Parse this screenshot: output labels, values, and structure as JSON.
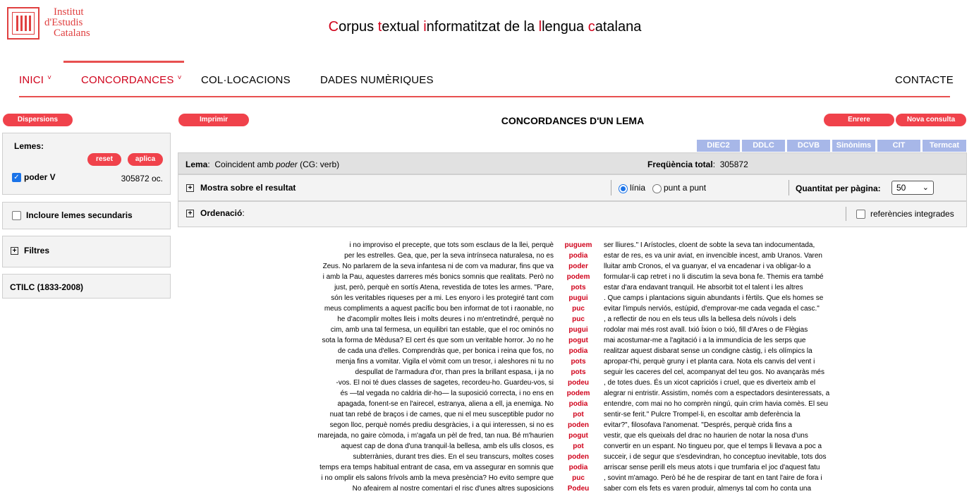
{
  "logo": {
    "line1": "Institut",
    "line2": "d'Estudis",
    "line3": "Catalans"
  },
  "site_title": {
    "parts": [
      {
        "t": "C",
        "red": true
      },
      {
        "t": "orpus ",
        "red": false
      },
      {
        "t": "t",
        "red": true
      },
      {
        "t": "extual ",
        "red": false
      },
      {
        "t": "i",
        "red": true
      },
      {
        "t": "nformatitzat de la ",
        "red": false
      },
      {
        "t": "l",
        "red": true
      },
      {
        "t": "lengua ",
        "red": false
      },
      {
        "t": "c",
        "red": true
      },
      {
        "t": "atalana",
        "red": false
      }
    ]
  },
  "nav": {
    "inici": "INICI",
    "concordances": "CONCORDANCES",
    "collocacions": "COL·LOCACIONS",
    "dades": "DADES NUMÈRIQUES",
    "contacte": "CONTACTE"
  },
  "buttons": {
    "dispersions": "Dispersions",
    "imprimir": "Imprimir",
    "enrere": "Enrere",
    "nova": "Nova consulta",
    "reset": "reset",
    "aplica": "aplica"
  },
  "page_title": "CONCORDANCES D'UN LEMA",
  "sidebar": {
    "lemes_label": "Lemes",
    "lema_item": "poder V",
    "lema_count": "305872 oc.",
    "secundaris": "Incloure lemes secundaris",
    "filtres": "Filtres",
    "ctilc": "CTILC (1833-2008)"
  },
  "dict_tabs": [
    "DIEC2",
    "DDLC",
    "DCVB",
    "Sinònims",
    "CIT",
    "Termcat"
  ],
  "lema_bar": {
    "label": "Lema",
    "desc_pre": "Coincident amb ",
    "desc_em": "poder",
    "desc_post": " (CG: verb)",
    "freq_label": "Freqüència total",
    "freq_value": "305872"
  },
  "options_bar": {
    "mostra": "Mostra sobre el resultat",
    "linia": "línia",
    "punt": "punt a punt",
    "quantitat": "Quantitat per pàgina:",
    "quantitat_value": "50"
  },
  "ordenacio_bar": {
    "label": "Ordenació",
    "referencies": "referències integrades"
  },
  "concordances": [
    {
      "l": "i no improviso el precepte, que tots som esclaus de la llei, perquè",
      "k": "puguem",
      "r": "ser lliures.\" I Arístocles, cloent de sobte la seva tan indocumentada,"
    },
    {
      "l": "per les estrelles. Gea, que, per la seva intrínseca naturalesa, no es",
      "k": "podia",
      "r": "estar de res, es va unir aviat, en invencible incest, amb Uranos. Varen"
    },
    {
      "l": "Zeus. No parlarem de la seva infantesa ni de com va madurar, fins que va",
      "k": "poder",
      "r": "lluitar amb Cronos, el va guanyar, el va encadenar i va obligar-lo a"
    },
    {
      "l": "i amb la Pau, aquestes darreres més bonics somnis que realitats. Però no",
      "k": "podem",
      "r": "formular-li cap retret i no li discutim la seva bona fe. Themis era també"
    },
    {
      "l": "just, però, perquè en sortís Atena, revestida de totes les armes. \"Pare,",
      "k": "pots",
      "r": "estar d'ara endavant tranquil. He absorbit tot el talent i les altres"
    },
    {
      "l": "són les veritables riqueses per a mi. Les enyoro i les protegiré tant com",
      "k": "pugui",
      "r": ". Que camps i plantacions siguin abundants i fèrtils. Que els homes se"
    },
    {
      "l": "meus compliments a aquest pacífic bou ben informat de tot i raonable, no",
      "k": "puc",
      "r": "evitar l'impuls nerviós, estúpid, d'emprovar-me cada vegada el casc.\""
    },
    {
      "l": "he d'acomplir moltes lleis i molts deures i no m'entretindré, perquè no",
      "k": "puc",
      "r": ", a reflectir de nou en els teus ulls la bellesa dels núvols i dels"
    },
    {
      "l": "cim, amb una tal fermesa, un equilibri tan estable, que el roc ominós no",
      "k": "pugui",
      "r": "rodolar mai més rost avall. Ixió Íxion o Ixió, fill d'Ares o de Flègias"
    },
    {
      "l": "sota la forma de Mèdusa? El cert és que som un veritable horror. Jo no he",
      "k": "pogut",
      "r": "mai acostumar-me a l'agitació i a la immundícia de les serps que"
    },
    {
      "l": "de cada una d'elles. Comprendràs que, per bonica i reina que fos, no",
      "k": "podia",
      "r": "realitzar aquest disbarat sense un condigne càstig, i els olímpics la"
    },
    {
      "l": "menja fins a vomitar. Vigila el vòmit com un tresor, i aleshores ni tu no",
      "k": "pots",
      "r": "apropar-t'hi, perquè gruny i et planta cara. Nota els canvis del vent i"
    },
    {
      "l": "despullat de l'armadura d'or, t'han pres la brillant espasa, i ja no",
      "k": "pots",
      "r": "seguir les caceres del cel, acompanyat del teu gos. No avançaràs més"
    },
    {
      "l": "-vos. El noi té dues classes de sagetes, recordeu-ho. Guardeu-vos, si",
      "k": "podeu",
      "r": ", de totes dues. És un xicot capriciós i cruel, que es diverteix amb el"
    },
    {
      "l": "és —tal vegada no caldria dir-ho— la suposició correcta, i no ens en",
      "k": "podem",
      "r": "alegrar ni entristir. Assistim, només com a espectadors desinteressats, a"
    },
    {
      "l": "apagada, fonent-se en l'airecel, estranya, aliena a ell, ja enemiga. No",
      "k": "podia",
      "r": "entendre, com mai no ho comprèn ningú, quin crim havia comès. El seu"
    },
    {
      "l": "nuat tan rebé de braços i de cames, que ni el meu susceptible pudor no",
      "k": "pot",
      "r": "sentir-se ferit.\" Pulcre Trompel·li, en escoltar amb deferència la"
    },
    {
      "l": "segon lloc, perquè només prediu desgràcies, i a qui interessen, si no es",
      "k": "poden",
      "r": "evitar?\", filosofava l'anomenat. \"Després, perquè crida fins a"
    },
    {
      "l": "marejada, no gaire còmoda, i m'agafa un pèl de fred, tan nua. Bé m'haurien",
      "k": "pogut",
      "r": "vestir, que els queixals del drac no haurien de notar la nosa d'uns"
    },
    {
      "l": "aquest cap de dona d'una tranquil·la bellesa, amb els ulls closos, es",
      "k": "pot",
      "r": "convertir en un espant. No tingueu por, que el temps li llevava a poc a"
    },
    {
      "l": "subterrànies, durant tres dies. En el seu transcurs, moltes coses",
      "k": "poden",
      "r": "succeir, i de segur que s'esdevindran, ho conceptuo inevitable, tots dos"
    },
    {
      "l": "temps era temps habitual entrant de casa, em va assegurar en somnis que",
      "k": "podia",
      "r": "arriscar sense perill els meus atots i que trumfaria el joc d'aquest fatu"
    },
    {
      "l": "i no omplir els salons frívols amb la meva presència? Ho evito sempre que",
      "k": "puc",
      "r": ", sovint m'amago. Però bé he de respirar de tant en tant l'aire de fora i"
    },
    {
      "l": "No afeairem al nostre comentari el risc d'unes altres suposicions",
      "k": "Podeu",
      "r": "saber com els fets es varen produir, almenys tal com ho conta una"
    }
  ]
}
